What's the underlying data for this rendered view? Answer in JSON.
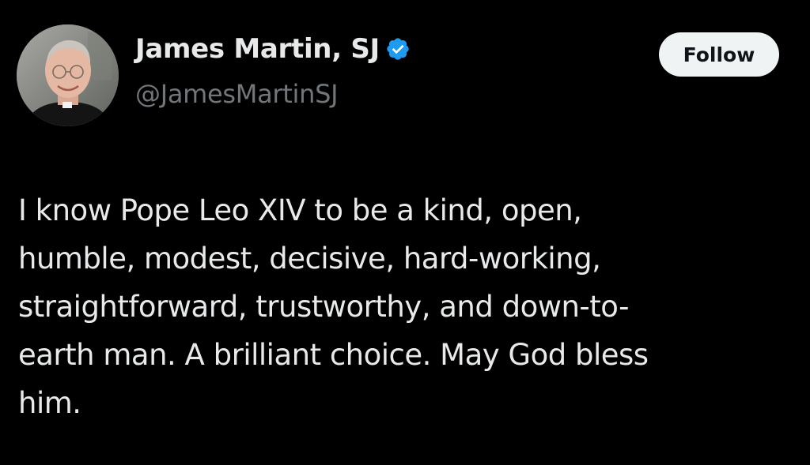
{
  "author": {
    "display_name": "James Martin, SJ",
    "handle": "@JamesMartinSJ",
    "verified": true,
    "avatar_icon": "profile-photo",
    "verified_icon": "verified-badge-icon"
  },
  "actions": {
    "follow_label": "Follow"
  },
  "tweet": {
    "text": "I know Pope Leo XIV to be a kind, open,\nhumble, modest, decisive, hard-working,\nstraightforward, trustworthy, and down-to-\nearth man. A brilliant choice. May God bless\nhim."
  },
  "colors": {
    "background": "#000000",
    "primary_text": "#e7e9ea",
    "secondary_text": "#71767b",
    "verified_blue": "#1d9bf0",
    "button_bg": "#eff3f4",
    "button_text": "#0f1419"
  }
}
